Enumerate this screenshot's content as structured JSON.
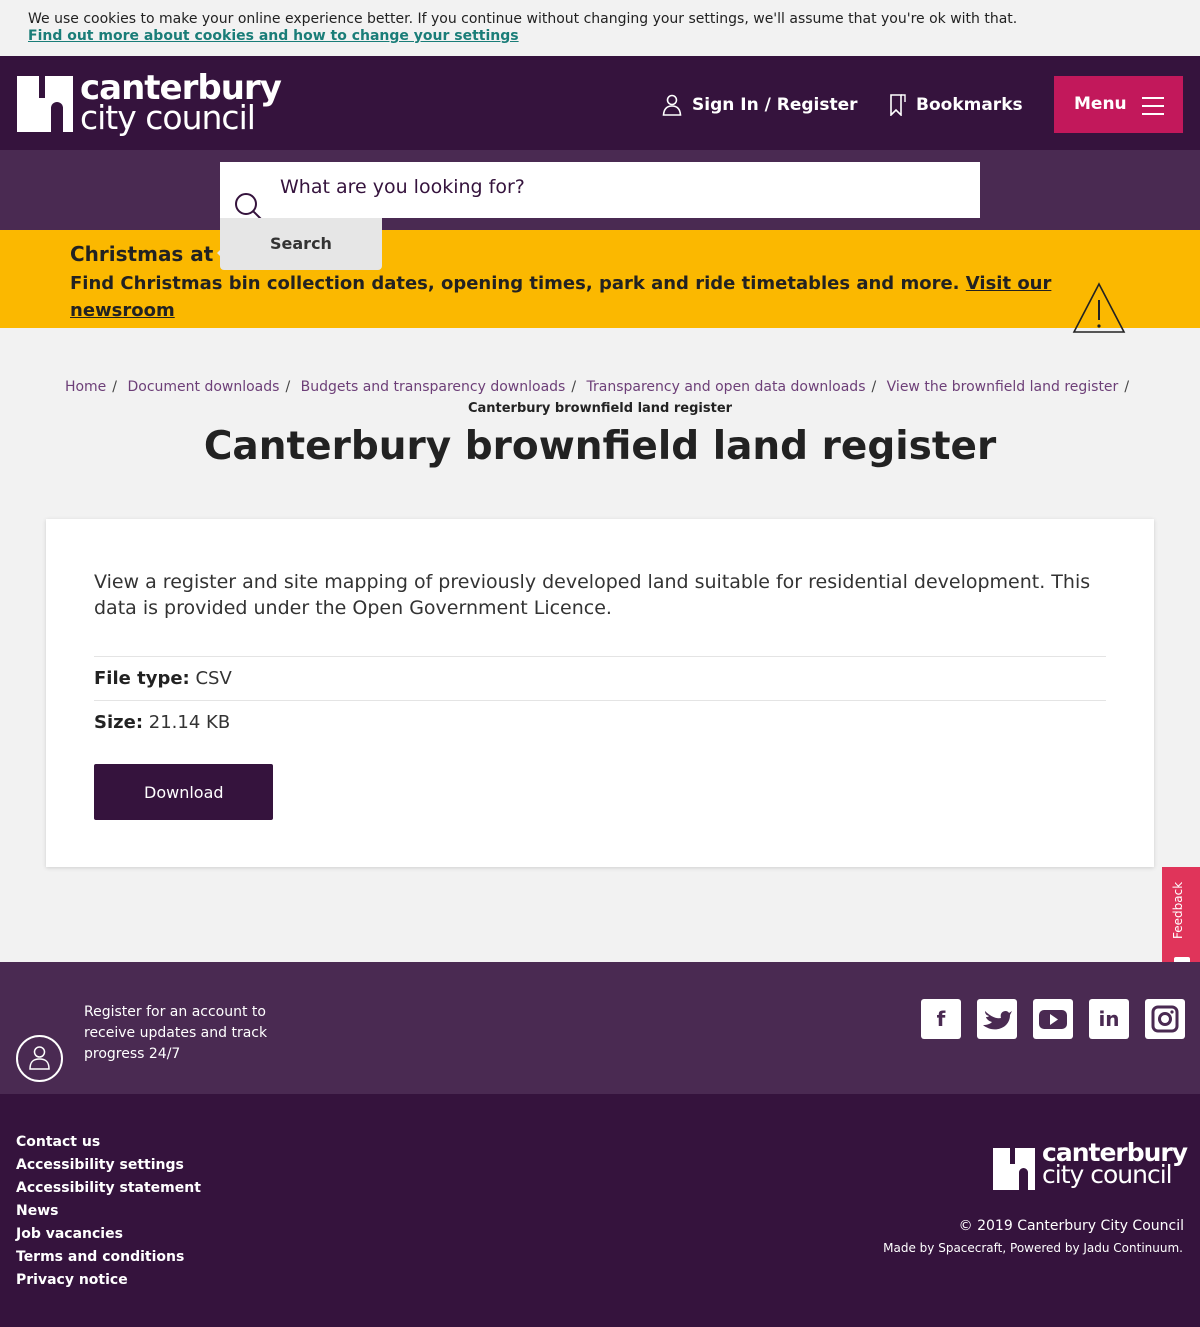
{
  "cookie": {
    "text": "We use cookies to make your online experience better. If you continue without changing your settings, we'll assume that you're ok with that.",
    "link": "Find out more about cookies and how to change your settings"
  },
  "header": {
    "logo_line1": "canterbury",
    "logo_line2": "city council",
    "signin": "Sign In / Register",
    "bookmarks": "Bookmarks",
    "menu": "Menu"
  },
  "search": {
    "placeholder": "What are you looking for?",
    "button": "Search"
  },
  "alert": {
    "title": "Christmas at the council",
    "body": "Find Christmas bin collection dates, opening times, park and ride timetables and more.",
    "link": "Visit our newsroom"
  },
  "breadcrumb": {
    "items": [
      "Home",
      "Document downloads",
      "Budgets and transparency downloads",
      "Transparency and open data downloads",
      "View the brownfield land register"
    ],
    "current": "Canterbury brownfield land register"
  },
  "page": {
    "title": "Canterbury brownfield land register",
    "description": "View a register and site mapping of previously developed land suitable for residential development. This data is provided under the Open Government Licence.",
    "file_type_label": "File type:",
    "file_type": "CSV",
    "size_label": "Size:",
    "size": "21.14 KB",
    "download": "Download"
  },
  "feedback": {
    "label": "Feedback"
  },
  "footer": {
    "register_text": "Register for an account to receive updates and track progress 24/7",
    "social": [
      "facebook-icon",
      "twitter-icon",
      "youtube-icon",
      "linkedin-icon",
      "instagram-icon"
    ],
    "links": [
      "Contact us",
      "Accessibility settings",
      "Accessibility statement",
      "News",
      "Job vacancies",
      "Terms and conditions",
      "Privacy notice"
    ],
    "logo_line1": "canterbury",
    "logo_line2": "city council",
    "copyright": "© 2019 Canterbury City Council",
    "made_by": "Made by Spacecraft, Powered by Jadu Continuum."
  },
  "colors": {
    "brand_purple": "#35133d",
    "band_purple": "#4a2a52",
    "accent_pink": "#c2185b",
    "alert_yellow": "#fbb800"
  }
}
